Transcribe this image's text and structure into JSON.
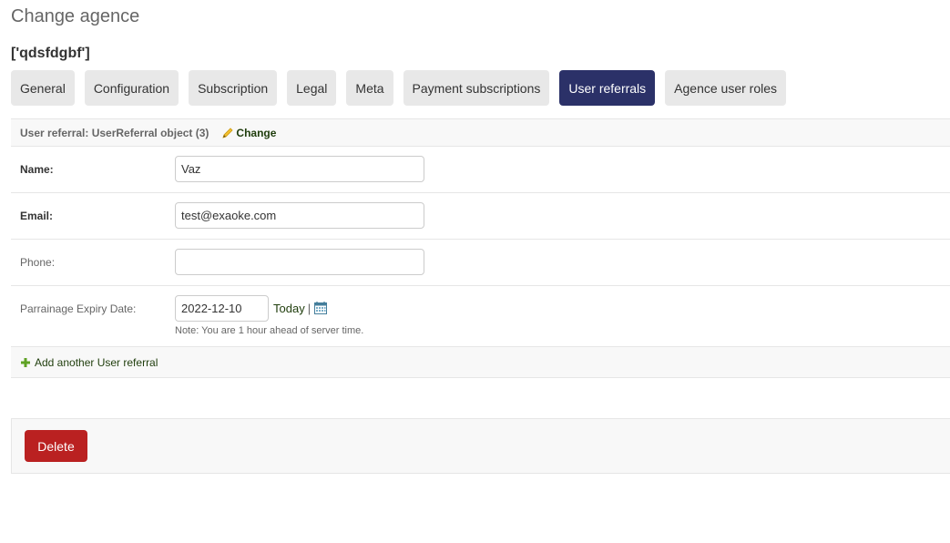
{
  "page": {
    "title": "Change agence",
    "object_name": "['qdsfdgbf']"
  },
  "tabs": [
    {
      "label": "General",
      "active": false
    },
    {
      "label": "Configuration",
      "active": false
    },
    {
      "label": "Subscription",
      "active": false
    },
    {
      "label": "Legal",
      "active": false
    },
    {
      "label": "Meta",
      "active": false
    },
    {
      "label": "Payment subscriptions",
      "active": false
    },
    {
      "label": "User referrals",
      "active": true
    },
    {
      "label": "Agence user roles",
      "active": false
    }
  ],
  "inline": {
    "header_label": "User referral: UserReferral object (3)",
    "change_label": "Change",
    "fields": {
      "name": {
        "label": "Name:",
        "value": ""
      },
      "email": {
        "label": "Email:",
        "value": ""
      },
      "phone": {
        "label": "Phone:",
        "value": ""
      },
      "expiry": {
        "label": "Parrainage Expiry Date:",
        "value": ""
      }
    },
    "name_value": "Vaz",
    "email_value": "test@exaoke.com",
    "phone_value": "",
    "expiry_value": "2022-12-10",
    "today_label": "Today",
    "separator": "|",
    "note": "Note: You are 1 hour ahead of server time.",
    "add_another_label": "Add another User referral"
  },
  "submit": {
    "delete_label": "Delete"
  },
  "icons": {
    "change": "pencil-icon",
    "calendar": "calendar-icon",
    "add": "plus-icon"
  },
  "colors": {
    "active_tab": "#2b3168",
    "delete": "#ba2121",
    "link": "#1f3d0c",
    "pencil": "#f5c02e",
    "plus": "#5fa225",
    "calendar": "#447e9b"
  }
}
